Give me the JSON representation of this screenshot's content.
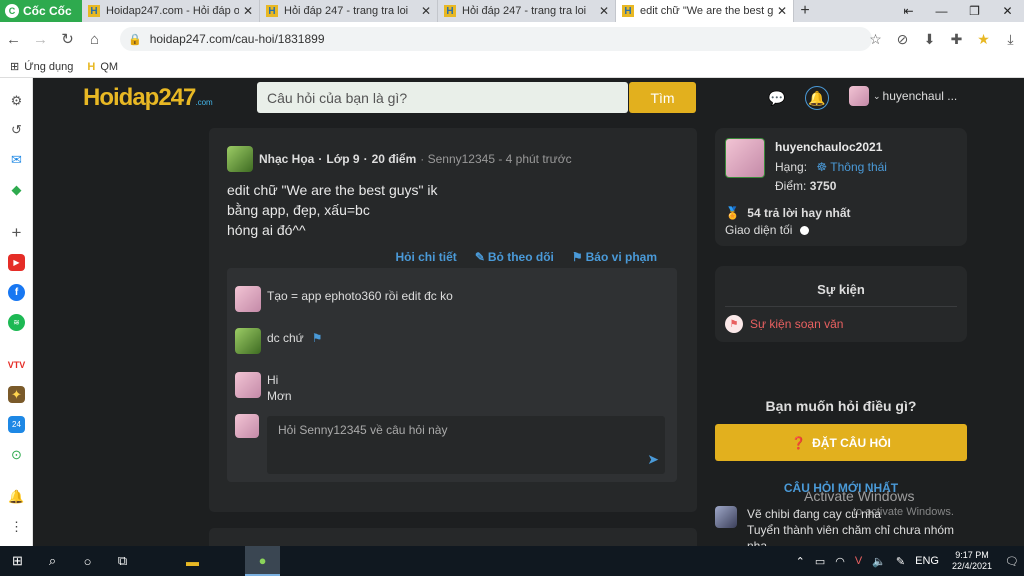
{
  "browser": {
    "brand": "Cốc Cốc",
    "tabs": [
      {
        "title": "Hoidap247.com - Hỏi đáp onl"
      },
      {
        "title": "Hỏi đáp 247 - trang tra loi"
      },
      {
        "title": "Hỏi đáp 247 - trang tra loi"
      },
      {
        "title": "edit chữ \"We are the best guys\""
      }
    ],
    "url": "hoidap247.com/cau-hoi/1831899",
    "bookmarks": [
      {
        "label": "Ứng dụng"
      },
      {
        "label": "QM"
      }
    ]
  },
  "site": {
    "logo": "Hoidap247",
    "logo_sub": ".com",
    "search_placeholder": "Câu hỏi của bạn là gì?",
    "search_button": "Tìm",
    "username_short": "huyenchaul ..."
  },
  "question": {
    "subject": "Nhạc Họa",
    "grade": "Lớp 9",
    "points": "20 điểm",
    "meta": "· Senny12345 - 4 phút trước",
    "lines": [
      "edit chữ \"We are the best guys\" ik",
      "bằng app, đẹp, xấu=bc",
      "hóng ai đó^^"
    ],
    "actions": {
      "detail": "Hỏi chi tiết",
      "unfollow": "Bỏ theo dõi",
      "report": "Báo vi phạm"
    },
    "comments": [
      {
        "lines": [
          "Tạo = app ephoto360 rồi edit đc ko"
        ]
      },
      {
        "lines": [
          "dc chứ"
        ]
      },
      {
        "lines": [
          "Hi",
          "Mơn"
        ]
      }
    ],
    "reply_placeholder": "Hỏi Senny12345 về câu hỏi này"
  },
  "profile": {
    "name": "huyenchauloc2021",
    "rank_label": "Hạng:",
    "rank": "Thông thái",
    "points_label": "Điểm:",
    "points": "3750",
    "best": "54 trả lời hay nhất",
    "dark_mode": "Giao diện tối"
  },
  "events": {
    "title": "Sự kiện",
    "item": "Sự kiện soạn văn"
  },
  "ask": {
    "title": "Bạn muốn hỏi điều gì?",
    "button": "ĐẶT CÂU HỎI",
    "newest": "CÂU HỎI MỚI NHẤT",
    "item_lines": [
      "Vẽ chibi đang cay cú nha",
      "Tuyển thành viên chăm chỉ chưa nhóm",
      "nha"
    ]
  },
  "watermark": {
    "title": "Activate Windows",
    "sub": "to activate Windows."
  },
  "taskbar": {
    "lang": "ENG",
    "time": "9:17 PM",
    "date": "22/4/2021"
  }
}
